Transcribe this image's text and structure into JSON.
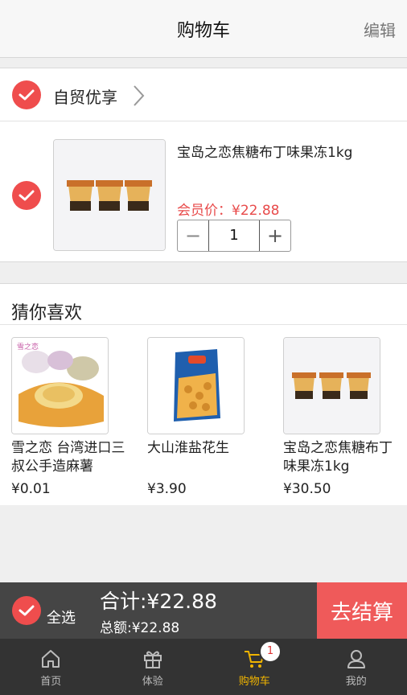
{
  "header": {
    "title": "购物车",
    "edit_label": "编辑"
  },
  "store": {
    "name": "自贸优享"
  },
  "cart_item": {
    "name": "宝岛之恋焦糖布丁味果冻1kg",
    "price": "会员价：¥22.88",
    "quantity": "1",
    "minus": "−",
    "plus": "+"
  },
  "recommend": {
    "title": "猜你喜欢",
    "items": [
      {
        "name": "雪之恋 台湾进口三叔公手造麻薯",
        "price": "¥0.01"
      },
      {
        "name": "大山淮盐花生",
        "price": "¥3.90"
      },
      {
        "name": "宝岛之恋焦糖布丁味果冻1kg",
        "price": "¥30.50"
      }
    ]
  },
  "checkout": {
    "select_all": "全选",
    "total": "合计:¥22.88",
    "sum": "总额:¥22.88",
    "pay_label": "去结算"
  },
  "tabbar": {
    "tabs": [
      {
        "label": "首页",
        "icon": "home-icon"
      },
      {
        "label": "体验",
        "icon": "gift-icon"
      },
      {
        "label": "购物车",
        "icon": "cart-icon"
      },
      {
        "label": "我的",
        "icon": "user-icon"
      }
    ],
    "cart_badge": "1",
    "active_color": "#f0b400"
  },
  "colors": {
    "accent": "#ef4d4d",
    "price": "#e84b4b",
    "checkout_bar": "#454545",
    "pay_button": "#ef5a5a",
    "tabbar": "#333333"
  }
}
